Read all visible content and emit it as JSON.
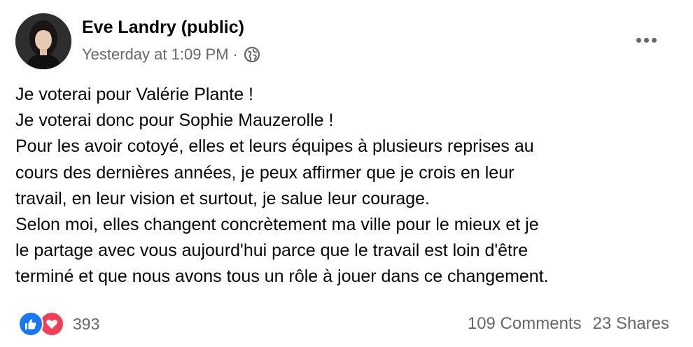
{
  "post": {
    "author": "Eve Landry (public)",
    "timestamp": "Yesterday at 1:09 PM",
    "separator": "·",
    "audience_icon": "globe-icon",
    "menu_icon": "more-horizontal-icon",
    "body_lines": [
      "Je voterai pour Valérie Plante !",
      "Je voterai donc pour Sophie Mauzerolle !",
      "Pour les avoir cotoyé, elles et leurs équipes à plusieurs reprises au",
      "cours des dernières années, je peux affirmer que je crois en leur",
      "travail, en leur vision et surtout, je salue leur courage.",
      "Selon moi, elles changent concrètement ma ville pour le mieux et je",
      "le partage avec vous aujourd'hui parce que le travail est loin d'être",
      "terminé et que nous avons tous un rôle à jouer dans ce changement."
    ]
  },
  "engagement": {
    "reaction_icons": [
      "like-icon",
      "love-icon"
    ],
    "reaction_count": "393",
    "comments": "109 Comments",
    "shares": "23 Shares"
  },
  "colors": {
    "text_primary": "#050505",
    "text_secondary": "#65676b",
    "like_blue": "#1877f2",
    "love_red": "#f33e58"
  }
}
